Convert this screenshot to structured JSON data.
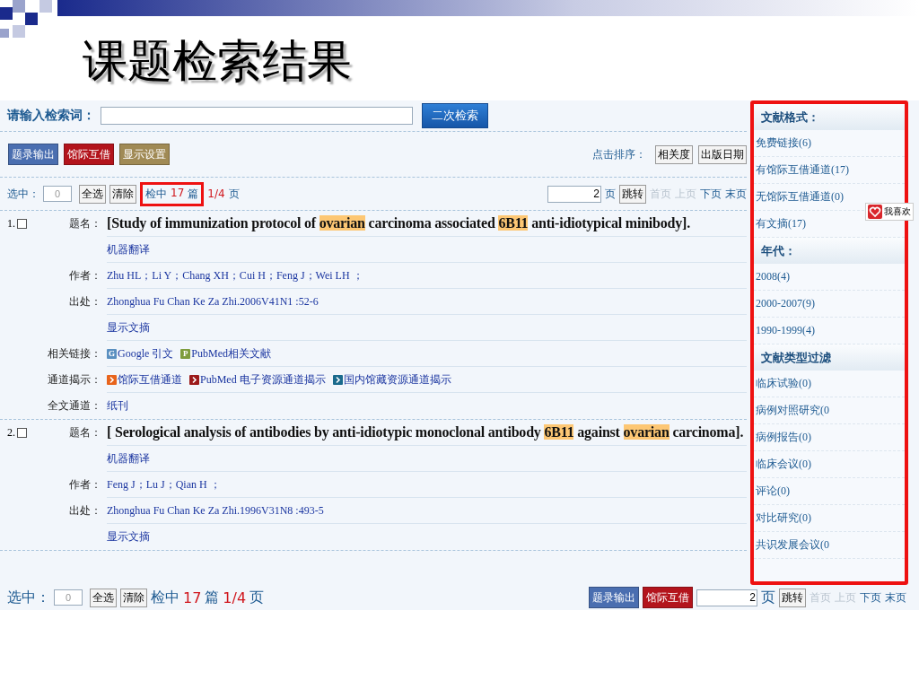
{
  "slide": {
    "title": "课题检索结果"
  },
  "search": {
    "label": "请输入检索词：",
    "button": "二次检索"
  },
  "toolbar": {
    "buttons": [
      {
        "label": "题录输出",
        "color": "#4a6eb0"
      },
      {
        "label": "馆际互借",
        "color": "#b3141c"
      },
      {
        "label": "显示设置",
        "color": "#a08a55"
      }
    ],
    "sort": {
      "label": "点击排序：",
      "options": [
        "相关度",
        "出版日期"
      ]
    }
  },
  "selection_bar": {
    "label": "选中：",
    "value": "0",
    "select_all": "全选",
    "clear": "清除",
    "hits_word": "检中",
    "hits": "17",
    "hits_unit": "篇",
    "pages": "1/4",
    "page_word": "页",
    "annotated": true,
    "page_input": "2",
    "page_unit": "页",
    "go": "跳转",
    "nav": [
      {
        "label": "首页",
        "disabled": true
      },
      {
        "label": "上页",
        "disabled": true
      },
      {
        "label": "下页",
        "disabled": false
      },
      {
        "label": "末页",
        "disabled": false
      }
    ]
  },
  "results": [
    {
      "number": "1.",
      "checked": false,
      "rows": [
        {
          "kind": "title",
          "label": "题名：",
          "segments": [
            {
              "text": "[Study of immunization protocol of ",
              "highlight": false
            },
            {
              "text": "ovarian",
              "highlight": true
            },
            {
              "text": " carcinoma associated ",
              "highlight": false
            },
            {
              "text": "6B11",
              "highlight": true
            },
            {
              "text": " anti-idiotypical minibody].",
              "highlight": false
            }
          ]
        },
        {
          "kind": "link",
          "text": "机器翻译"
        },
        {
          "kind": "text",
          "label": "作者：",
          "text": "Zhu HL；Li Y；Chang XH；Cui H；Feng J；Wei LH ；"
        },
        {
          "kind": "text",
          "label": "出处：",
          "text": "Zhonghua Fu Chan Ke Za Zhi.2006V41N1 :52-6"
        },
        {
          "kind": "link",
          "text": "显示文摘"
        },
        {
          "kind": "links",
          "label": "相关链接：",
          "links": [
            {
              "text": "Google 引文",
              "badge": "G",
              "color": "#5a8fc0"
            },
            {
              "text": "PubMed相关文献",
              "badge": "P",
              "color": "#7e9c3c"
            }
          ]
        },
        {
          "kind": "links",
          "label": "通道揭示：",
          "links": [
            {
              "text": "馆际互借通道",
              "color": "#e8641c"
            },
            {
              "text": "PubMed 电子资源通道揭示",
              "color": "#9c1a1a"
            },
            {
              "text": "国内馆藏资源通道揭示",
              "color": "#1a6a8c"
            }
          ]
        },
        {
          "kind": "link",
          "label": "全文通道：",
          "text": "纸刊"
        }
      ]
    },
    {
      "number": "2.",
      "checked": false,
      "rows": [
        {
          "kind": "title",
          "label": "题名：",
          "segments": [
            {
              "text": "[ Serological analysis of antibodies by anti-idiotypic monoclonal antibody ",
              "highlight": false
            },
            {
              "text": "6B11",
              "highlight": true
            },
            {
              "text": " against ",
              "highlight": false
            },
            {
              "text": "ovarian",
              "highlight": true
            },
            {
              "text": " carcinoma].",
              "highlight": false
            }
          ]
        },
        {
          "kind": "link",
          "text": "机器翻译"
        },
        {
          "kind": "text",
          "label": "作者：",
          "text": "Feng J；Lu J；Qian H ；"
        },
        {
          "kind": "text",
          "label": "出处：",
          "text": "Zhonghua Fu Chan Ke Za Zhi.1996V31N8 :493-5"
        },
        {
          "kind": "link",
          "text": "显示文摘"
        }
      ]
    }
  ],
  "bottom_bar": {
    "label": "选中：",
    "value": "0",
    "select_all": "全选",
    "clear": "清除",
    "hits_word": "检中",
    "hits": "17",
    "hits_unit": "篇",
    "pages": "1/4",
    "page_word": "页",
    "buttons": [
      {
        "label": "题录输出",
        "color": "#4a6eb0"
      },
      {
        "label": "馆际互借",
        "color": "#b3141c"
      }
    ],
    "page_input": "2",
    "page_unit": "页",
    "go": "跳转",
    "nav": [
      {
        "label": "首页",
        "disabled": true
      },
      {
        "label": "上页",
        "disabled": true
      },
      {
        "label": "下页",
        "disabled": false
      },
      {
        "label": "末页",
        "disabled": false
      }
    ]
  },
  "sidebar": {
    "annotated": true,
    "like_button": "我喜欢",
    "sections": [
      {
        "heading": "文献格式：",
        "items": [
          "免费链接(6)",
          "有馆际互借通道(17)",
          "无馆际互借通道(0)",
          "有文摘(17)"
        ]
      },
      {
        "heading": "年代：",
        "items": [
          "2008(4)",
          "2000-2007(9)",
          "1990-1999(4)"
        ]
      },
      {
        "heading": "文献类型过滤",
        "items": [
          "临床试验(0)",
          "病例对照研究(0",
          "病例报告(0)",
          "临床会议(0)",
          "评论(0)",
          "对比研究(0)",
          "共识发展会议(0"
        ]
      }
    ]
  }
}
